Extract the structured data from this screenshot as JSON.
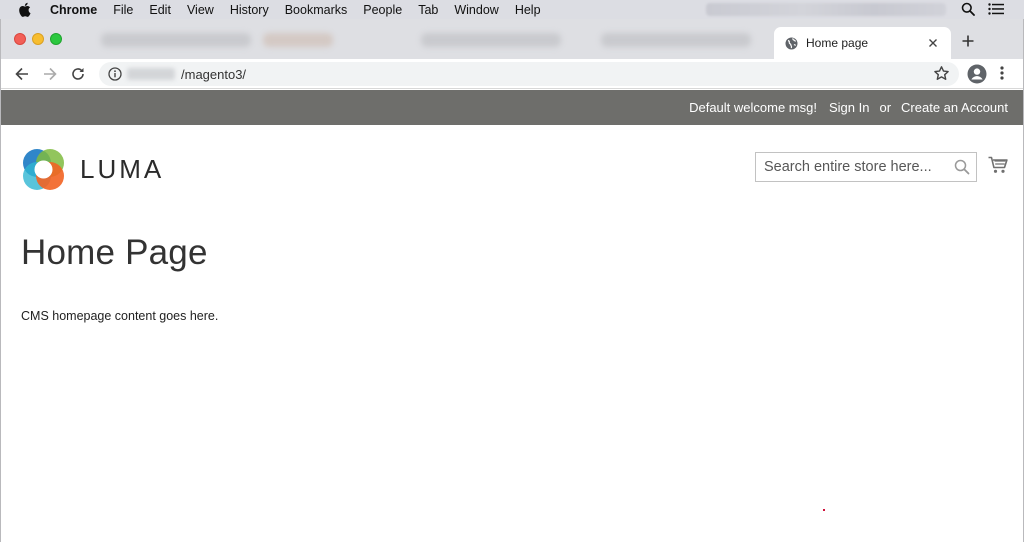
{
  "mac_menubar": {
    "app_name": "Chrome",
    "items": [
      "File",
      "Edit",
      "View",
      "History",
      "Bookmarks",
      "People",
      "Tab",
      "Window",
      "Help"
    ]
  },
  "browser": {
    "active_tab_title": "Home page",
    "url_path": "/magento3/"
  },
  "store": {
    "header": {
      "welcome_msg": "Default welcome msg!",
      "sign_in": "Sign In",
      "or": "or",
      "create_account": "Create an Account"
    },
    "logo_text": "LUMA",
    "search_placeholder": "Search entire store here...",
    "page_title": "Home Page",
    "cms_content": "CMS homepage content goes here."
  },
  "colors": {
    "panel_header_bg": "#6e6e6b",
    "logo_blue": "#1979c3",
    "logo_orange": "#f26322",
    "logo_green": "#7fbb3f"
  }
}
